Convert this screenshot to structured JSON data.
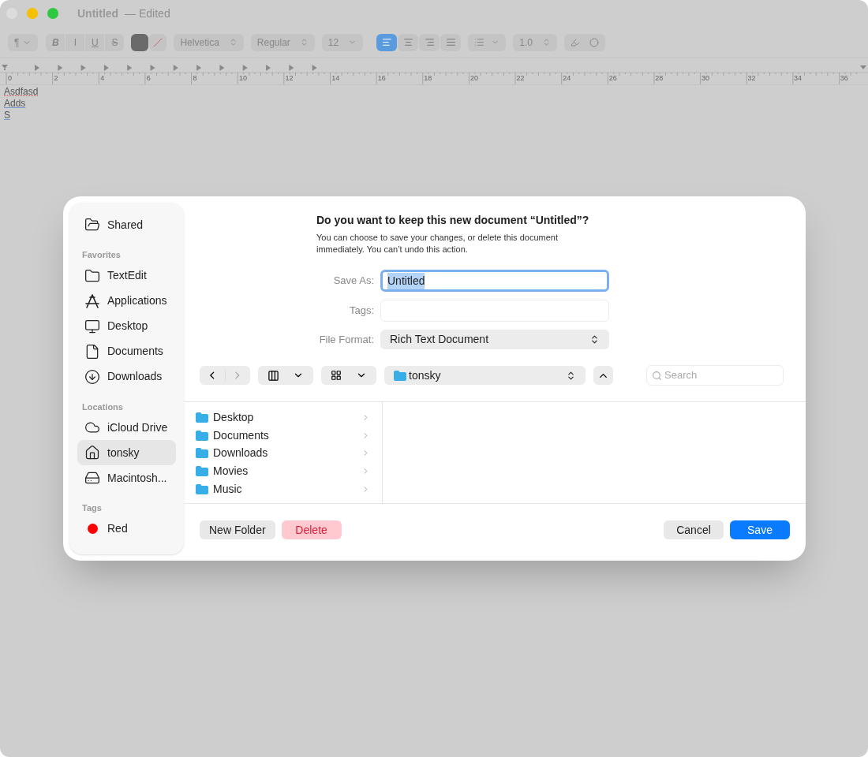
{
  "window": {
    "title": "Untitled",
    "subtitle": "— Edited"
  },
  "toolbar": [
    {
      "kind": "menu",
      "text": "¶"
    },
    {
      "kind": "style",
      "text": "B"
    },
    {
      "kind": "style",
      "text": "I"
    },
    {
      "kind": "style",
      "text": "U"
    },
    {
      "kind": "style",
      "text": "S"
    },
    {
      "kind": "swatch"
    },
    {
      "kind": "clear"
    },
    {
      "kind": "popup",
      "text": "Helvetica"
    },
    {
      "kind": "popup",
      "text": "Regular"
    },
    {
      "kind": "combo",
      "text": "12"
    },
    {
      "kind": "align",
      "selected": true
    },
    {
      "kind": "align",
      "selected": false
    },
    {
      "kind": "align",
      "selected": false
    },
    {
      "kind": "align",
      "selected": false
    },
    {
      "kind": "list"
    },
    {
      "kind": "popup",
      "text": "1.0"
    },
    {
      "kind": "highlight"
    }
  ],
  "ruler": [
    "0",
    "2",
    "4",
    "6",
    "8",
    "10",
    "12",
    "14",
    "16",
    "18",
    "20",
    "22",
    "24",
    "26",
    "28",
    "30",
    "32",
    "34",
    "36"
  ],
  "document": [
    {
      "text": "Asdfasd",
      "misspelled": true
    },
    {
      "text": "Adds",
      "misspelled": false
    },
    {
      "text": "S",
      "misspelled": false
    }
  ],
  "dialog": {
    "sidebar": [
      {
        "items": [
          {
            "label": "Shared",
            "selected": false
          }
        ]
      },
      {
        "heading": "Favorites",
        "items": [
          {
            "label": "TextEdit",
            "selected": false
          },
          {
            "label": "Applications",
            "selected": false
          },
          {
            "label": "Desktop",
            "selected": false
          },
          {
            "label": "Documents",
            "selected": false
          },
          {
            "label": "Downloads",
            "selected": false
          }
        ]
      },
      {
        "heading": "Locations",
        "items": [
          {
            "label": "iCloud Drive",
            "selected": false
          },
          {
            "label": "tonsky",
            "selected": true
          },
          {
            "label": "Macintosh...",
            "selected": false
          }
        ]
      },
      {
        "heading": "Tags",
        "items": [
          {
            "label": "Red",
            "selected": false,
            "color": "#ff0000"
          }
        ]
      }
    ],
    "title": "Do you want to keep this new document “Untitled”?",
    "message": "You can choose to save your changes, or delete this document immediately. You can’t undo this action.",
    "save_as": {
      "label": "Save As:",
      "value": "Untitled",
      "focused": true
    },
    "tags": {
      "label": "Tags:"
    },
    "file_format": {
      "label": "File Format:",
      "value": "Rich Text Document"
    },
    "location": "tonsky",
    "search": {
      "placeholder": "Search"
    },
    "files": [
      "Desktop",
      "Documents",
      "Downloads",
      "Movies",
      "Music"
    ],
    "buttons": [
      {
        "label": "New Folder",
        "kind": "plain"
      },
      {
        "label": "Delete",
        "kind": "destructive"
      },
      {
        "label": "Cancel",
        "kind": "plain"
      },
      {
        "label": "Save",
        "kind": "default"
      }
    ]
  }
}
